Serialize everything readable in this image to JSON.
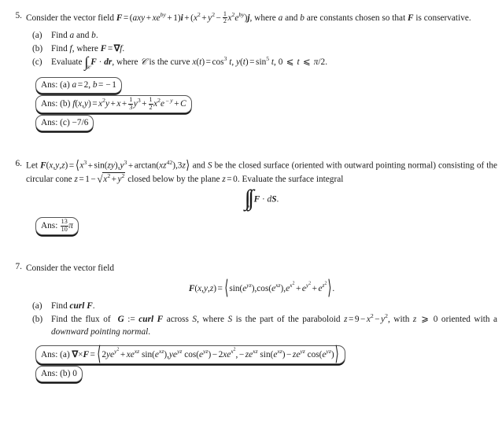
{
  "document": {
    "type": "math-worksheet-answers",
    "problems": [
      {
        "number": "5.",
        "statement_lead": "Consider the vector field",
        "statement_tail": ", where",
        "statement_tail2": "and",
        "statement_tail3": "are constants chosen so that",
        "statement_tail4": "is conservative.",
        "field_expression": "F = (axy + xe^{by} + 1)i + (x^2 + y^2 - (1/2)x^2 e^{by})j",
        "parts": [
          {
            "label": "(a)",
            "text": "Find a and b."
          },
          {
            "label": "(b)",
            "text": "Find f, where F = ∇f."
          },
          {
            "label": "(c)",
            "text": "Evaluate ∫_C F · dr, where C is the curve x(t) = cos^3 t, y(t) = sin^5 t, 0 ⩽ t ⩽ π/2."
          }
        ],
        "answers": [
          {
            "label": "Ans:",
            "part": "(a)",
            "value": "a = 2, b = −1"
          },
          {
            "label": "Ans:",
            "part": "(b)",
            "value": "f(x,y) = x^2 y + x + (1/3)y^3 + (1/2)x^2 e^{−y} + C"
          },
          {
            "label": "Ans:",
            "part": "(c)",
            "value": "−7/6"
          }
        ]
      },
      {
        "number": "6.",
        "statement": "Let F(x, y, z) = ⟨x^3+sin(zy), y^3+arctan(xz^42), 3z⟩ and S be the closed surface (oriented with outward pointing normal) consisting of the circular cone z = 1 − √(x^2 + y^2) closed below by the plane z = 0. Evaluate the surface integral",
        "display_equation": "∬_S F · dS.",
        "answers": [
          {
            "label": "Ans:",
            "part": "",
            "value": "13/10 π"
          }
        ]
      },
      {
        "number": "7.",
        "statement": "Consider the vector field",
        "display_equation": "F(x, y, z) = ⟨sin(e^{yz}), cos(e^{xz}), e^{x^2} + e^{y^2} + e^{z^2}⟩.",
        "parts": [
          {
            "label": "(a)",
            "text": "Find curl F."
          },
          {
            "label": "(b)",
            "text": "Find the flux of G := curl F across S, where S is the part of the paraboloid z = 9 − x^2 − y^2, with z ⩾ 0 oriented with a downward pointing normal."
          }
        ],
        "answers": [
          {
            "label": "Ans:",
            "part": "(a)",
            "value": "∇×F = ⟨2ye^{y^2} + xe^{xz} sin(e^{xz}), ye^{yz} cos(e^{yz}) − 2xe^{x^2}, −ze^{xz} sin(e^{xz}) − ze^{yz} cos(e^{yz})⟩"
          },
          {
            "label": "Ans:",
            "part": "(b)",
            "value": "0"
          }
        ]
      }
    ],
    "words": {
      "consider": "Consider the vector field",
      "where": "where",
      "and": "and",
      "are_constants": "are constants",
      "chosen_so_that": "chosen so that",
      "is_conservative": "is conservative.",
      "find": "Find",
      "find_a_and_b_pre": "Find",
      "evaluate": "Evaluate",
      "where_c_is_curve": "where",
      "is_the_curve": "is the curve",
      "let": "Let",
      "and_s_be": "and",
      "be_closed_surface": "be the closed surface (oriented with outward",
      "pointing_normal": "pointing normal) consisting of the circular cone",
      "closed_below": "closed below by the plane",
      "evaluate_surface_integral": "Evaluate the surface integral",
      "find_curl": "Find",
      "curl": "curl",
      "find_flux": "Find the flux of",
      "assign": ":=",
      "across": "across",
      "where_s_part": ", where",
      "is_part_paraboloid": "is the part of the paraboloid",
      "with": "with",
      "oriented_with": "oriented with a",
      "downward_pointing_normal": "downward pointing normal",
      "ans": "Ans:"
    },
    "colors": {
      "text": "#1a1a1a",
      "box_border": "#555555",
      "box_shadow": "#111111",
      "background": "#ffffff"
    }
  }
}
